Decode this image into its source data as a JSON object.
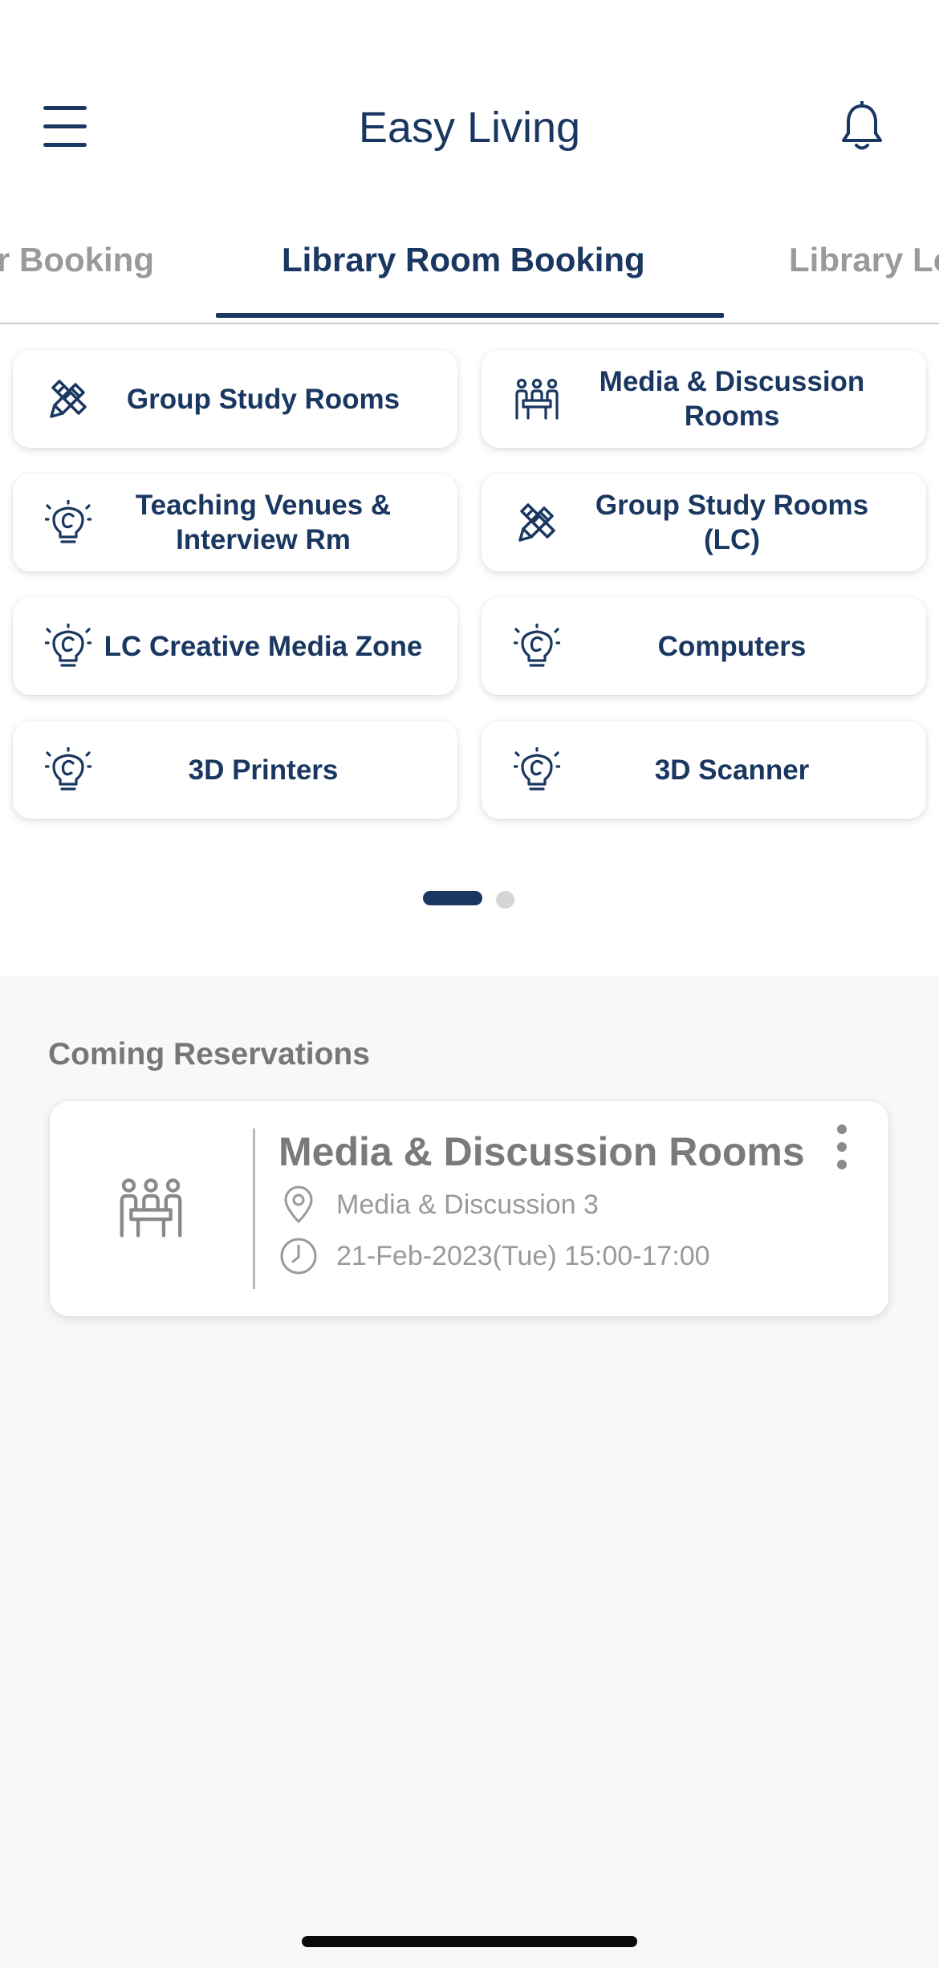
{
  "header": {
    "title": "Easy Living",
    "menu_icon": "hamburger-menu-icon",
    "notification_icon": "bell-icon"
  },
  "tabs": [
    {
      "label": "r Booking",
      "active": false
    },
    {
      "label": "Library Room Booking",
      "active": true
    },
    {
      "label": "Library Lo",
      "active": false
    }
  ],
  "categories": [
    {
      "label": "Group Study Rooms",
      "icon": "pencil-ruler-icon"
    },
    {
      "label": "Media & Discussion Rooms",
      "icon": "meeting-people-icon"
    },
    {
      "label": "Teaching Venues & Interview Rm",
      "icon": "lightbulb-icon"
    },
    {
      "label": "Group Study Rooms (LC)",
      "icon": "pencil-ruler-icon"
    },
    {
      "label": "LC Creative Media Zone",
      "icon": "lightbulb-icon"
    },
    {
      "label": "Computers",
      "icon": "lightbulb-icon"
    },
    {
      "label": "3D Printers",
      "icon": "lightbulb-icon"
    },
    {
      "label": "3D Scanner",
      "icon": "lightbulb-icon"
    }
  ],
  "pager": {
    "pages": 2,
    "current": 1
  },
  "reservations": {
    "section_title": "Coming Reservations",
    "items": [
      {
        "title": "Media & Discussion Rooms",
        "location": "Media & Discussion 3",
        "datetime": "21-Feb-2023(Tue) 15:00-17:00",
        "icon": "meeting-people-icon"
      }
    ]
  },
  "colors": {
    "primary": "#1a3761",
    "inactive_text": "#9a9a9a",
    "background": "#f8f8f8",
    "card": "#ffffff"
  }
}
